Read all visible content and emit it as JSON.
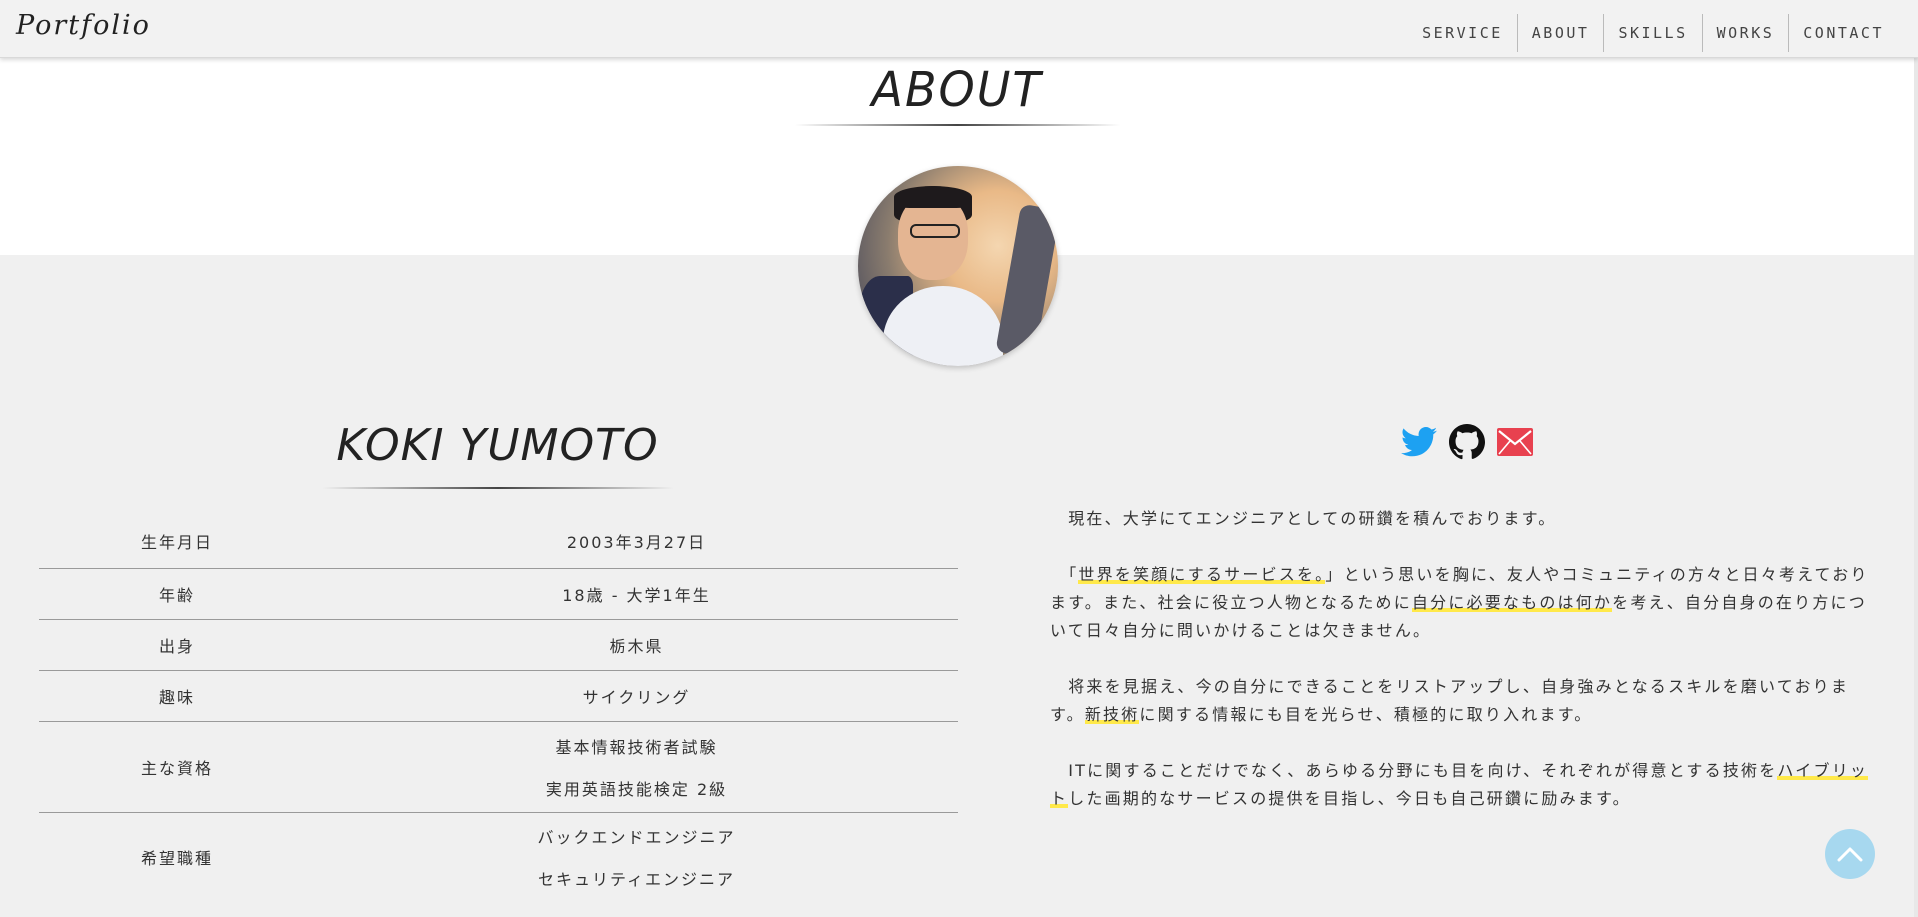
{
  "header": {
    "logo": "Portfolio",
    "nav": [
      "SERVICE",
      "ABOUT",
      "SKILLS",
      "WORKS",
      "CONTACT"
    ]
  },
  "about": {
    "title": "ABOUT",
    "name": "KOKI YUMOTO",
    "profile": [
      {
        "label": "生年月日",
        "values": [
          "2003年3月27日"
        ]
      },
      {
        "label": "年齢",
        "values": [
          "18歳 - 大学1年生"
        ]
      },
      {
        "label": "出身",
        "values": [
          "栃木県"
        ]
      },
      {
        "label": "趣味",
        "values": [
          "サイクリング"
        ]
      },
      {
        "label": "主な資格",
        "values": [
          "基本情報技術者試験",
          "実用英語技能検定 2級"
        ]
      },
      {
        "label": "希望職種",
        "values": [
          "バックエンドエンジニア",
          "セキュリティエンジニア"
        ]
      }
    ],
    "socials": [
      {
        "name": "twitter-icon",
        "color": "#1da1f2"
      },
      {
        "name": "github-icon",
        "color": "#111111"
      },
      {
        "name": "mail-icon",
        "color": "#e8414f"
      }
    ],
    "bio": {
      "p1": "　現在、大学にてエンジニアとしての研鑽を積んでおります。",
      "p2a": "　「",
      "p2b": "世界を笑顔にするサービスを。",
      "p2c": "」という思いを胸に、友人やコミュニティの方々と日々考えております。また、社会に役立つ人物となるために",
      "p2d": "自分に必要なものは何か",
      "p2e": "を考え、自分自身の在り方について日々自分に問いかけることは欠きません。",
      "p3a": "　将来を見据え、今の自分にできることをリストアップし、自身強みとなるスキルを磨いております。",
      "p3b": "新技術",
      "p3c": "に関する情報にも目を光らせ、積極的に取り入れます。",
      "p4a": "　ITに関することだけでなく、あらゆる分野にも目を向け、それぞれが得意とする技術を",
      "p4b": "ハイブリット",
      "p4c": "した画期的なサービスの提供を目指し、今日も自己研鑽に励みます。"
    },
    "accent_highlight": "#ffe94a"
  },
  "to_top": {
    "icon": "chevron-up-icon",
    "color": "#a7d8ef"
  }
}
